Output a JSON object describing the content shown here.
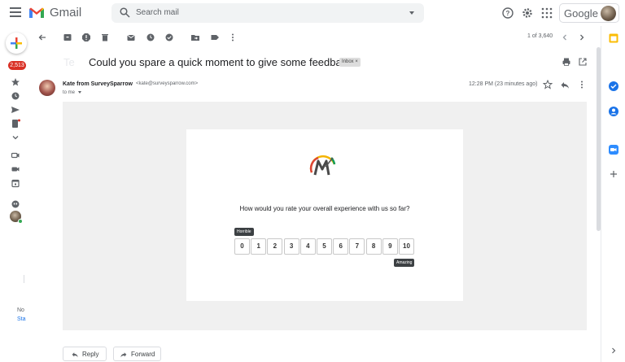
{
  "app": {
    "name": "Gmail"
  },
  "search": {
    "placeholder": "Search mail"
  },
  "account": {
    "label": "Google"
  },
  "rail": {
    "inbox_count": "2,513",
    "promo_line1": "No",
    "promo_line2": "Sta"
  },
  "toolbar": {
    "pager": "1 of 3,640"
  },
  "email": {
    "subject": "Could you spare a quick moment to give some feedback?",
    "subject_ghost": "Te",
    "label_chip": "Inbox",
    "chip_close": "×",
    "sender_name": "Kate from SurveySparrow",
    "sender_email": "<kate@surveysparrow.com>",
    "to": "to me",
    "time": "12:28 PM (23 minutes ago)"
  },
  "survey": {
    "question": "How would you rate your overall experience with us so far?",
    "scale": [
      "0",
      "1",
      "2",
      "3",
      "4",
      "5",
      "6",
      "7",
      "8",
      "9",
      "10"
    ],
    "low_label": "Horrible",
    "high_label": "Amazing"
  },
  "actions": {
    "reply": "Reply",
    "forward": "Forward"
  },
  "colors": {
    "accent_red": "#d93025",
    "surface": "#f0f0f0",
    "text": "#202124",
    "muted": "#5f6368"
  },
  "icons": [
    "menu-icon",
    "gmail-logo-icon",
    "search-icon",
    "help-icon",
    "settings-icon",
    "apps-icon",
    "back-icon",
    "archive-icon",
    "spam-icon",
    "delete-icon",
    "mark-unread-icon",
    "snooze-icon",
    "add-task-icon",
    "move-icon",
    "label-icon",
    "more-icon",
    "print-icon",
    "open-new-window-icon",
    "star-icon",
    "reply-icon",
    "forward-icon"
  ]
}
